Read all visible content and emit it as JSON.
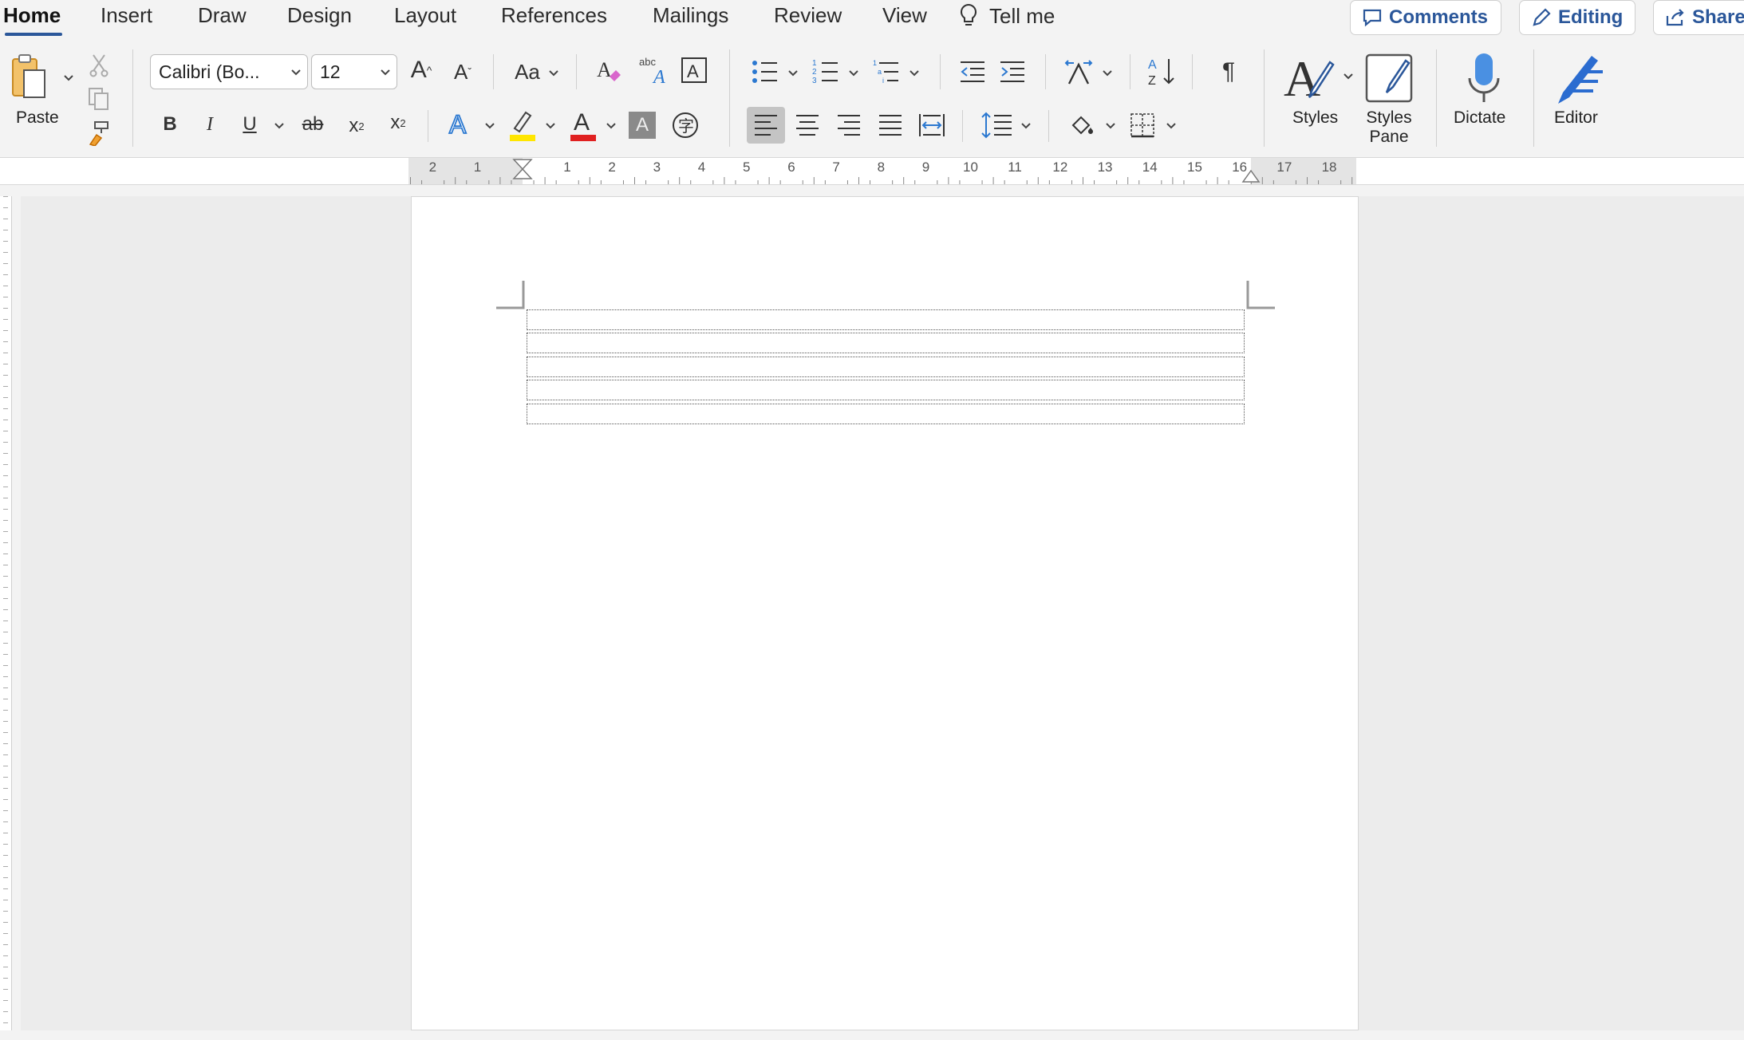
{
  "tabs": [
    "Home",
    "Insert",
    "Draw",
    "Design",
    "Layout",
    "References",
    "Mailings",
    "Review",
    "View"
  ],
  "tell_me": "Tell me",
  "actions": {
    "comments": "Comments",
    "editing": "Editing",
    "share": "Share"
  },
  "ribbon": {
    "paste": "Paste",
    "font_name": "Calibri (Bo...",
    "font_size": "12",
    "change_case": "Aa",
    "styles": "Styles",
    "styles_pane_1": "Styles",
    "styles_pane_2": "Pane",
    "dictate": "Dictate",
    "editor": "Editor"
  },
  "ruler_numbers": [
    "2",
    "1",
    "1",
    "2",
    "3",
    "4",
    "5",
    "6",
    "7",
    "8",
    "9",
    "10",
    "11",
    "12",
    "13",
    "14",
    "15",
    "16",
    "17",
    "18"
  ],
  "colors": {
    "accent": "#2b579a",
    "highlight": "#ffe600",
    "font_color": "#e02020"
  }
}
